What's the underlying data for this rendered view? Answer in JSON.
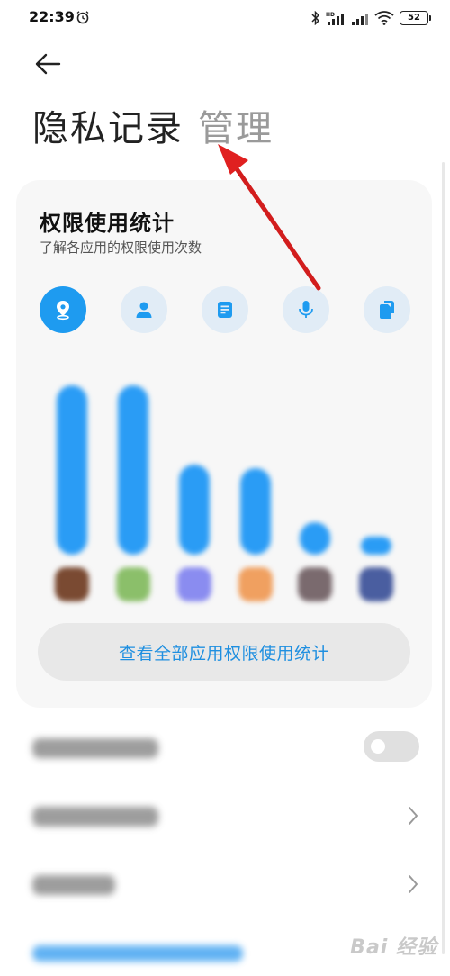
{
  "status_bar": {
    "time": "22:39",
    "battery": "52",
    "icons": [
      "alarm-icon",
      "bluetooth-icon",
      "hd-signal-icon",
      "signal-icon",
      "wifi-icon",
      "battery-icon"
    ]
  },
  "header": {
    "back_icon": "arrow-left-icon",
    "title": "隐私记录",
    "manage_label": "管理"
  },
  "card": {
    "title": "权限使用统计",
    "subtitle": "了解各应用的权限使用次数",
    "permission_tabs": [
      {
        "icon": "location-icon",
        "active": true
      },
      {
        "icon": "contacts-icon",
        "active": false
      },
      {
        "icon": "sms-icon",
        "active": false
      },
      {
        "icon": "microphone-icon",
        "active": false
      },
      {
        "icon": "clipboard-icon",
        "active": false
      }
    ],
    "view_all_label": "查看全部应用权限使用统计"
  },
  "colors": {
    "accent": "#1e9bf0",
    "tab_inactive": "#e1ecf6",
    "annotation_arrow": "#e02020"
  },
  "watermark": "Bai 经验"
}
